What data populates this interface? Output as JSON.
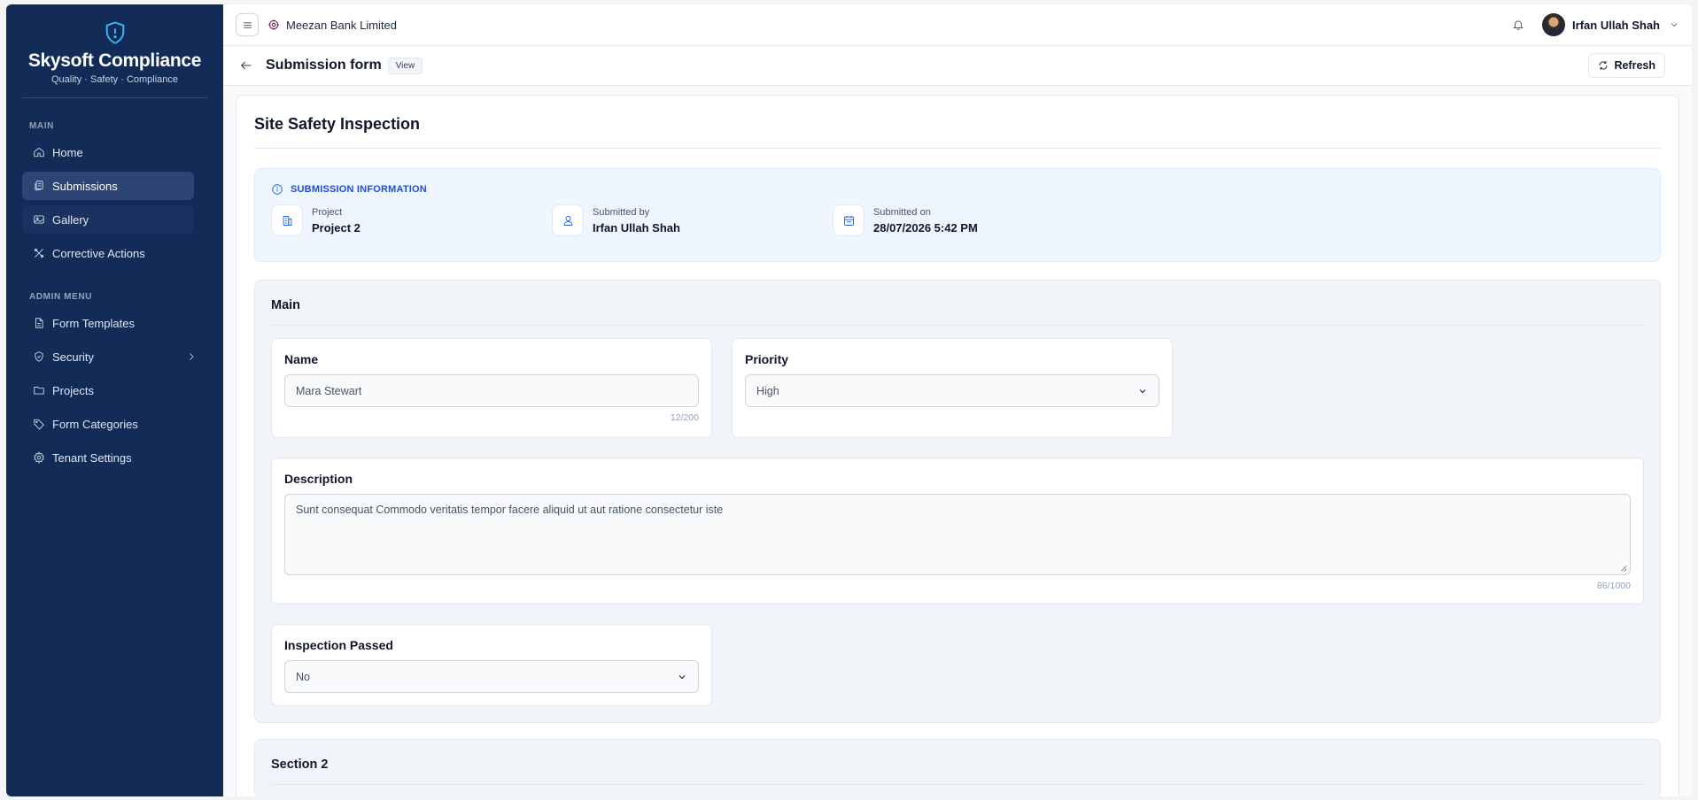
{
  "brand": {
    "title": "Skysoft Compliance",
    "subtitle": "Quality · Safety · Compliance"
  },
  "sidebar": {
    "main_label": "MAIN",
    "main_items": [
      {
        "label": "Home",
        "icon": "home-icon"
      },
      {
        "label": "Submissions",
        "icon": "files-icon",
        "active": true
      },
      {
        "label": "Gallery",
        "icon": "image-icon"
      },
      {
        "label": "Corrective Actions",
        "icon": "tools-icon"
      }
    ],
    "admin_label": "ADMIN MENU",
    "admin_items": [
      {
        "label": "Form Templates",
        "icon": "file-icon"
      },
      {
        "label": "Security",
        "icon": "shield-icon"
      },
      {
        "label": "Projects",
        "icon": "folder-icon"
      },
      {
        "label": "Form Categories",
        "icon": "tag-icon"
      },
      {
        "label": "Tenant Settings",
        "icon": "gear-icon"
      }
    ]
  },
  "topbar": {
    "org_name": "Meezan Bank Limited",
    "user_name": "Irfan Ullah Shah"
  },
  "subbar": {
    "title": "Submission form",
    "badge": "View",
    "refresh_label": "Refresh"
  },
  "form": {
    "title": "Site Safety Inspection",
    "info": {
      "heading": "SUBMISSION INFORMATION",
      "project_label": "Project",
      "project_value": "Project 2",
      "submitted_by_label": "Submitted by",
      "submitted_by_value": "Irfan Ullah Shah",
      "submitted_on_label": "Submitted on",
      "submitted_on_value": "28/07/2026 5:42 PM"
    },
    "section_main": {
      "title": "Main",
      "name_label": "Name",
      "name_value": "Mara Stewart",
      "name_counter": "12/200",
      "priority_label": "Priority",
      "priority_value": "High",
      "description_label": "Description",
      "description_value": "Sunt consequat Commodo veritatis tempor facere aliquid ut aut ratione consectetur iste",
      "description_counter": "86/1000",
      "inspection_label": "Inspection Passed",
      "inspection_value": "No"
    },
    "section_2": {
      "title": "Section 2"
    }
  },
  "colors": {
    "sidebar_bg": "#122b57",
    "active_item": "#2d4574",
    "accent": "#2563eb",
    "info_bg": "#eff6ff"
  }
}
